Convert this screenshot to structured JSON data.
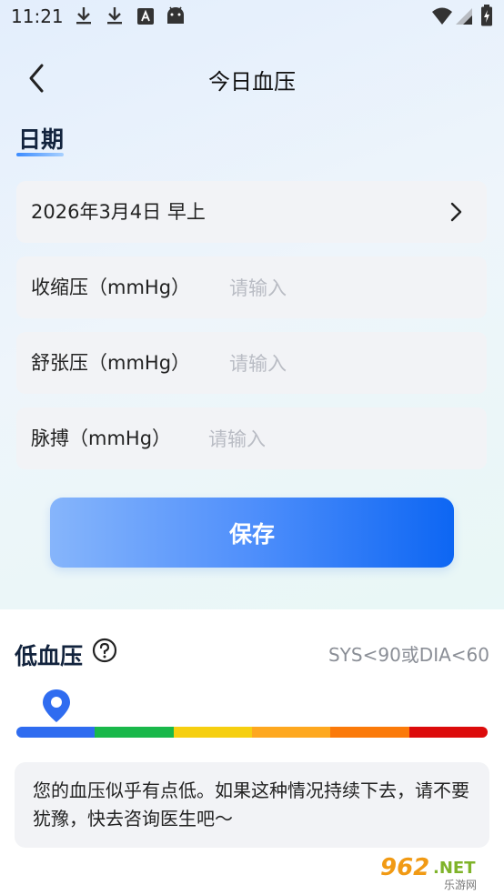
{
  "status_bar": {
    "time": "11:21",
    "icons": [
      "download-icon",
      "download-icon",
      "a-notification-icon",
      "android-icon",
      "wifi-icon",
      "signal-icon",
      "battery-charging-icon"
    ]
  },
  "header": {
    "title": "今日血压",
    "back_icon": "chevron-left-icon"
  },
  "date_section": {
    "title": "日期"
  },
  "form": {
    "date_value": "2026年3月4日 早上",
    "systolic_label": "收缩压（mmHg）",
    "systolic_placeholder": "请输入",
    "diastolic_label": "舒张压（mmHg）",
    "diastolic_placeholder": "请输入",
    "pulse_label": "脉搏（mmHg）",
    "pulse_placeholder": "请输入",
    "save_label": "保存"
  },
  "result": {
    "title": "低血压",
    "range": "SYS<90或DIA<60",
    "scale_colors": [
      "#2f6cf0",
      "#19b84a",
      "#f6cf10",
      "#fea81f",
      "#fb7a0a",
      "#dc0b0b"
    ],
    "pointer_level": 0,
    "advice": "您的血压似乎有点低。如果这种情况持续下去，请不要犹豫，快去咨询医生吧～"
  },
  "watermark": {
    "logo": "962",
    "suffix": ".NET",
    "subtext": "乐游网"
  },
  "colors": {
    "accent": "#1068f3",
    "title_dark": "#12233d",
    "card_bg": "#f2f3f6",
    "placeholder": "#b9bcc4"
  }
}
